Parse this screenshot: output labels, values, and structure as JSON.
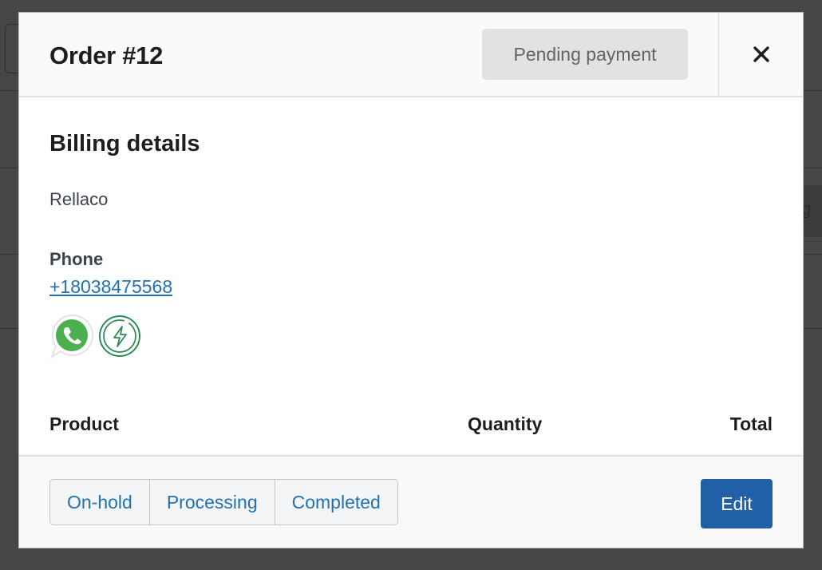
{
  "background": {
    "partial_text": "g"
  },
  "modal": {
    "title": "Order #12",
    "status_badge": "Pending payment",
    "close_icon": "close-icon",
    "billing": {
      "heading": "Billing details",
      "company": "Rellaco",
      "phone_label": "Phone",
      "phone_value": "+18038475568",
      "icons": [
        "whatsapp-icon",
        "lightning-icon"
      ]
    },
    "table": {
      "columns": [
        "Product",
        "Quantity",
        "Total"
      ]
    },
    "footer": {
      "status_buttons": [
        "On-hold",
        "Processing",
        "Completed"
      ],
      "edit_label": "Edit"
    }
  },
  "colors": {
    "accent": "#2060a6",
    "link": "#2271b1",
    "badge_bg": "#e2e2e2"
  }
}
